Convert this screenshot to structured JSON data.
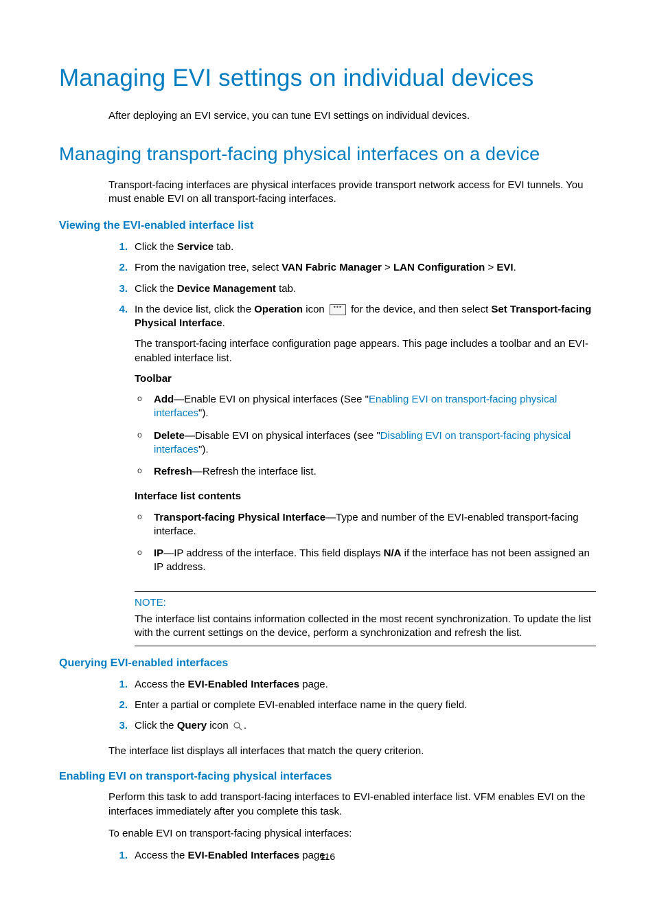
{
  "page_number": "116",
  "h1": "Managing EVI settings on individual devices",
  "h1_intro": "After deploying an EVI service, you can tune EVI settings on individual devices.",
  "h2": "Managing transport-facing physical interfaces on a device",
  "h2_intro": "Transport-facing interfaces are physical interfaces provide transport network access for EVI tunnels. You must enable EVI on all transport-facing interfaces.",
  "sec_view": {
    "title": "Viewing the EVI-enabled interface list",
    "step1_a": "Click the ",
    "step1_b": "Service",
    "step1_c": " tab.",
    "step2_a": "From the navigation tree, select ",
    "step2_b": "VAN Fabric Manager",
    "step2_c": " > ",
    "step2_d": "LAN Configuration",
    "step2_e": " > ",
    "step2_f": "EVI",
    "step2_g": ".",
    "step3_a": "Click the ",
    "step3_b": "Device Management",
    "step3_c": " tab.",
    "step4_a": "In the device list, click the ",
    "step4_b": "Operation",
    "step4_c": " icon ",
    "step4_d": " for the device, and then select ",
    "step4_e": "Set Transport-facing Physical Interface",
    "step4_f": ".",
    "step4_p1": "The transport-facing interface configuration page appears. This page includes a toolbar and an EVI-enabled interface list.",
    "toolbar_label": "Toolbar",
    "tb_add_b": "Add",
    "tb_add_t1": "—Enable EVI on physical interfaces (See \"",
    "tb_add_link": "Enabling EVI on transport-facing physical interfaces",
    "tb_add_t2": "\").",
    "tb_del_b": "Delete",
    "tb_del_t1": "—Disable EVI on physical interfaces (see \"",
    "tb_del_link": "Disabling EVI on transport-facing physical interfaces",
    "tb_del_t2": "\").",
    "tb_ref_b": "Refresh",
    "tb_ref_t": "—Refresh the interface list.",
    "ilc_label": "Interface list contents",
    "ilc_tp_b": "Transport-facing Physical Interface",
    "ilc_tp_t": "—Type and number of the EVI-enabled transport-facing interface.",
    "ilc_ip_b": "IP",
    "ilc_ip_t1": "—IP address of the interface. This field displays ",
    "ilc_ip_na": "N/A",
    "ilc_ip_t2": " if the interface has not been assigned an IP address.",
    "note_title": "NOTE:",
    "note_body": "The interface list contains information collected in the most recent synchronization. To update the list with the current settings on the device, perform a synchronization and refresh the list."
  },
  "sec_query": {
    "title": "Querying EVI-enabled interfaces",
    "step1_a": "Access the ",
    "step1_b": "EVI-Enabled Interfaces",
    "step1_c": " page.",
    "step2": "Enter a partial or complete EVI-enabled interface name in the query field.",
    "step3_a": "Click the ",
    "step3_b": "Query",
    "step3_c": " icon ",
    "step3_d": ".",
    "result": "The interface list displays all interfaces that match the query criterion."
  },
  "sec_enable": {
    "title": "Enabling EVI on transport-facing physical interfaces",
    "p1": "Perform this task to add transport-facing interfaces to EVI-enabled interface list. VFM enables EVI on the interfaces immediately after you complete this task.",
    "p2": "To enable EVI on transport-facing physical interfaces:",
    "step1_a": "Access the ",
    "step1_b": "EVI-Enabled Interfaces",
    "step1_c": " page."
  },
  "nums": {
    "n1": "1.",
    "n2": "2.",
    "n3": "3.",
    "n4": "4."
  }
}
